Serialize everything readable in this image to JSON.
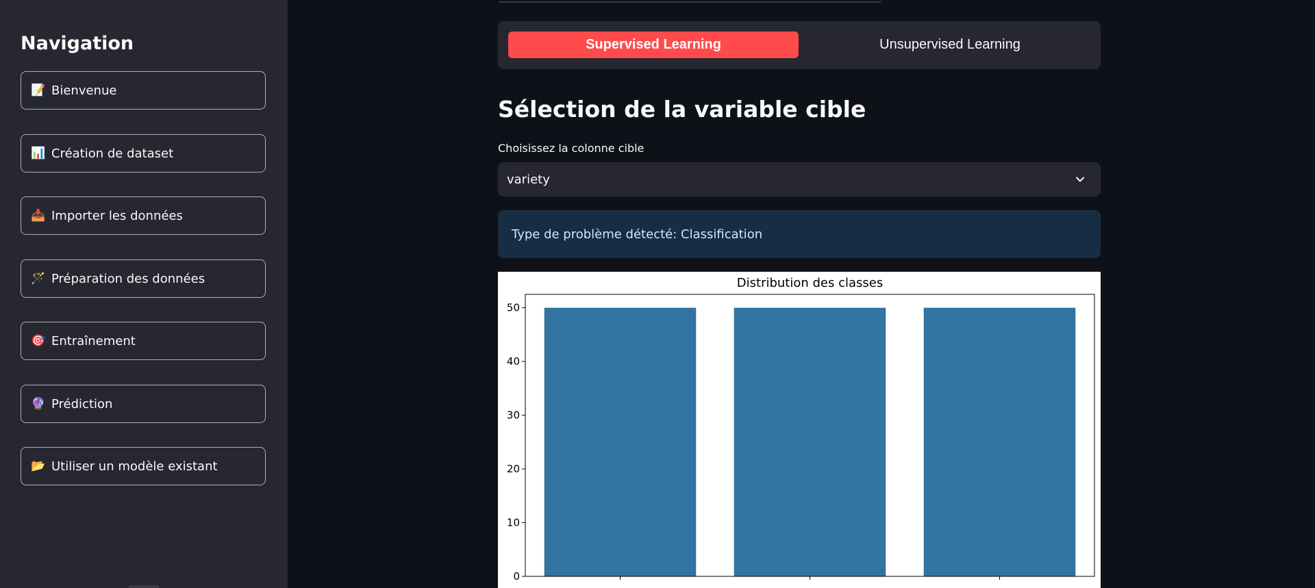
{
  "sidebar": {
    "title": "Navigation",
    "items": [
      {
        "icon": "📝",
        "icon_name": "memo-icon",
        "label": "Bienvenue"
      },
      {
        "icon": "📊",
        "icon_name": "bar-chart-icon",
        "label": "Création de dataset"
      },
      {
        "icon": "📥",
        "icon_name": "inbox-tray-icon",
        "label": "Importer les données"
      },
      {
        "icon": "🪄",
        "icon_name": "magic-wand-icon",
        "label": "Préparation des données"
      },
      {
        "icon": "🎯",
        "icon_name": "target-icon",
        "label": "Entraînement"
      },
      {
        "icon": "🔮",
        "icon_name": "crystal-ball-icon",
        "label": "Prédiction"
      },
      {
        "icon": "📂",
        "icon_name": "folder-icon",
        "label": "Utiliser un modèle existant"
      }
    ]
  },
  "tabs": {
    "active": "Supervised Learning",
    "inactive": "Unsupervised Learning"
  },
  "main": {
    "heading": "Sélection de la variable cible",
    "select_label": "Choisissez la colonne cible",
    "select_value": "variety",
    "info_text": "Type de problème détecté: Classification"
  },
  "colors": {
    "accent": "#ff4b4b",
    "background": "#0e1117",
    "sidebar": "#262730",
    "info_bg": "#172d43",
    "bar": "#3274a1"
  },
  "chart_data": {
    "type": "bar",
    "title": "Distribution des classes",
    "categories": [
      "",
      "",
      ""
    ],
    "values": [
      50,
      50,
      50
    ],
    "yticks": [
      0,
      10,
      20,
      30,
      40,
      50
    ],
    "ylim": [
      0,
      52.5
    ],
    "xlabel": "",
    "ylabel": "",
    "grid": false
  }
}
